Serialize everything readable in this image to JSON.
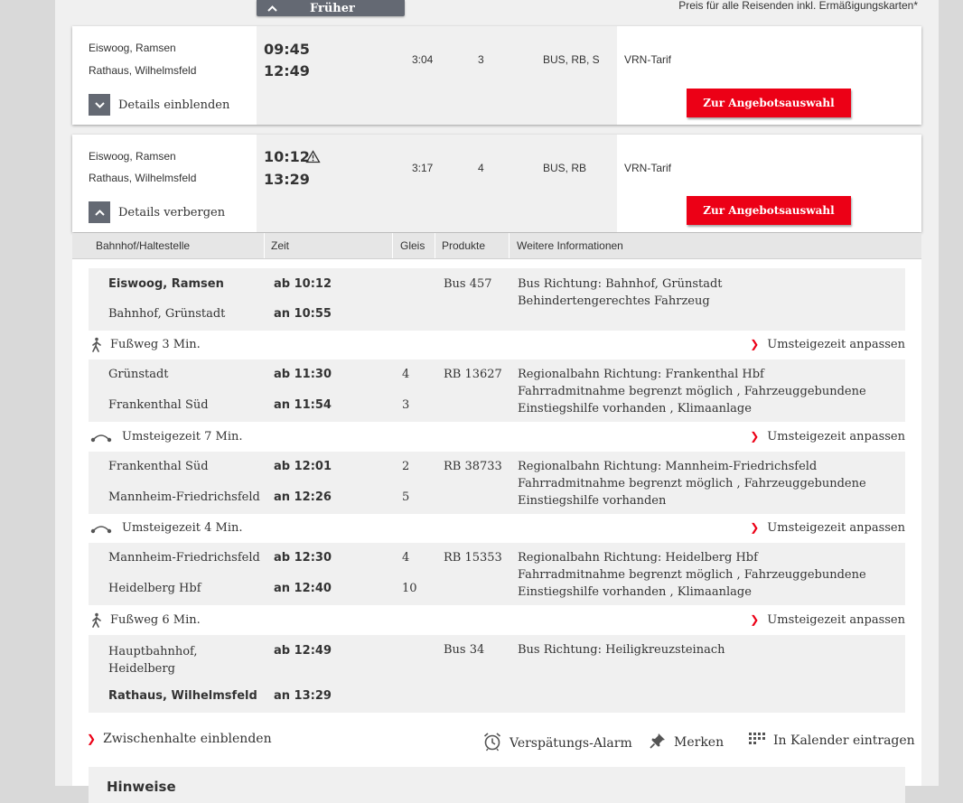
{
  "top": {
    "earlier_label": "Früher",
    "price_note": "Preis für alle Reisenden inkl. Ermäßigungskarten*"
  },
  "connections": [
    {
      "from": "Eiswoog, Ramsen",
      "to": "Rathaus, Wilhelmsfeld",
      "dep": "09:45",
      "arr": "12:49",
      "duration": "3:04",
      "changes": "3",
      "products": "BUS, RB, S",
      "tariff": "VRN-Tarif",
      "toggle_label": "Details einblenden",
      "offer_label": "Zur Angebotsauswahl"
    },
    {
      "from": "Eiswoog, Ramsen",
      "to": "Rathaus, Wilhelmsfeld",
      "dep": "10:12",
      "arr": "13:29",
      "duration": "3:17",
      "changes": "4",
      "products": "BUS, RB",
      "tariff": "VRN-Tarif",
      "toggle_label": "Details verbergen",
      "offer_label": "Zur Angebotsauswahl"
    }
  ],
  "table_headers": [
    "Bahnhof/Haltestelle",
    "Zeit",
    "Gleis",
    "Produkte",
    "Weitere Informationen"
  ],
  "segments": [
    {
      "dep_station": "Eiswoog, Ramsen",
      "dep_time": "ab 10:12",
      "dep_track": "",
      "arr_station": "Bahnhof, Grünstadt",
      "arr_time": "an 10:55",
      "arr_track": "",
      "product": "Bus 457",
      "info": [
        "Bus Richtung: Bahnhof, Grünstadt",
        "Behindertengerechtes Fahrzeug"
      ]
    },
    {
      "dep_station": "Grünstadt",
      "dep_time": "ab 11:30",
      "dep_track": "4",
      "arr_station": "Frankenthal Süd",
      "arr_time": "an 11:54",
      "arr_track": "3",
      "product": "RB 13627",
      "info": [
        "Regionalbahn Richtung: Frankenthal Hbf",
        "Fahrradmitnahme begrenzt möglich , Fahrzeuggebundene",
        "Einstiegshilfe vorhanden , Klimaanlage"
      ]
    },
    {
      "dep_station": "Frankenthal Süd",
      "dep_time": "ab 12:01",
      "dep_track": "2",
      "arr_station": "Mannheim-Friedrichsfeld",
      "arr_time": "an 12:26",
      "arr_track": "5",
      "product": "RB 38733",
      "info": [
        "Regionalbahn Richtung: Mannheim-Friedrichsfeld",
        "Fahrradmitnahme begrenzt möglich , Fahrzeuggebundene",
        "Einstiegshilfe vorhanden"
      ]
    },
    {
      "dep_station": "Mannheim-Friedrichsfeld",
      "dep_time": "ab 12:30",
      "dep_track": "4",
      "arr_station": "Heidelberg Hbf",
      "arr_time": "an 12:40",
      "arr_track": "10",
      "product": "RB 15353",
      "info": [
        "Regionalbahn Richtung: Heidelberg Hbf",
        "Fahrradmitnahme begrenzt möglich , Fahrzeuggebundene",
        "Einstiegshilfe vorhanden , Klimaanlage"
      ]
    },
    {
      "dep_station_1": "Hauptbahnhof,",
      "dep_station_2": "Heidelberg",
      "dep_time": "ab 12:49",
      "dep_track": "",
      "arr_station": "Rathaus, Wilhelmsfeld",
      "arr_time": "an 13:29",
      "arr_track": "",
      "product": "Bus 34",
      "info": [
        "Bus Richtung: Heiligkreuzsteinach"
      ]
    }
  ],
  "transfers": [
    {
      "label": "Fußweg 3 Min.",
      "icon": "walking-icon",
      "adjust": "Umsteigezeit anpassen"
    },
    {
      "label": "Umsteigezeit 7 Min.",
      "icon": "transfer-icon",
      "adjust": "Umsteigezeit anpassen"
    },
    {
      "label": "Umsteigezeit 4 Min.",
      "icon": "transfer-icon",
      "adjust": "Umsteigezeit anpassen"
    },
    {
      "label": "Fußweg 6 Min.",
      "icon": "walking-icon",
      "adjust": "Umsteigezeit anpassen"
    }
  ],
  "footer": {
    "intermediate_stops": "Zwischenhalte einblenden",
    "delay_alarm": "Verspätungs-Alarm",
    "bookmark": "Merken",
    "calendar": "In Kalender eintragen",
    "notes_heading": "Hinweise"
  },
  "colors": {
    "accent_red": "#ec0016",
    "button_grey": "#646973",
    "panel_grey": "#f0f0f0"
  }
}
